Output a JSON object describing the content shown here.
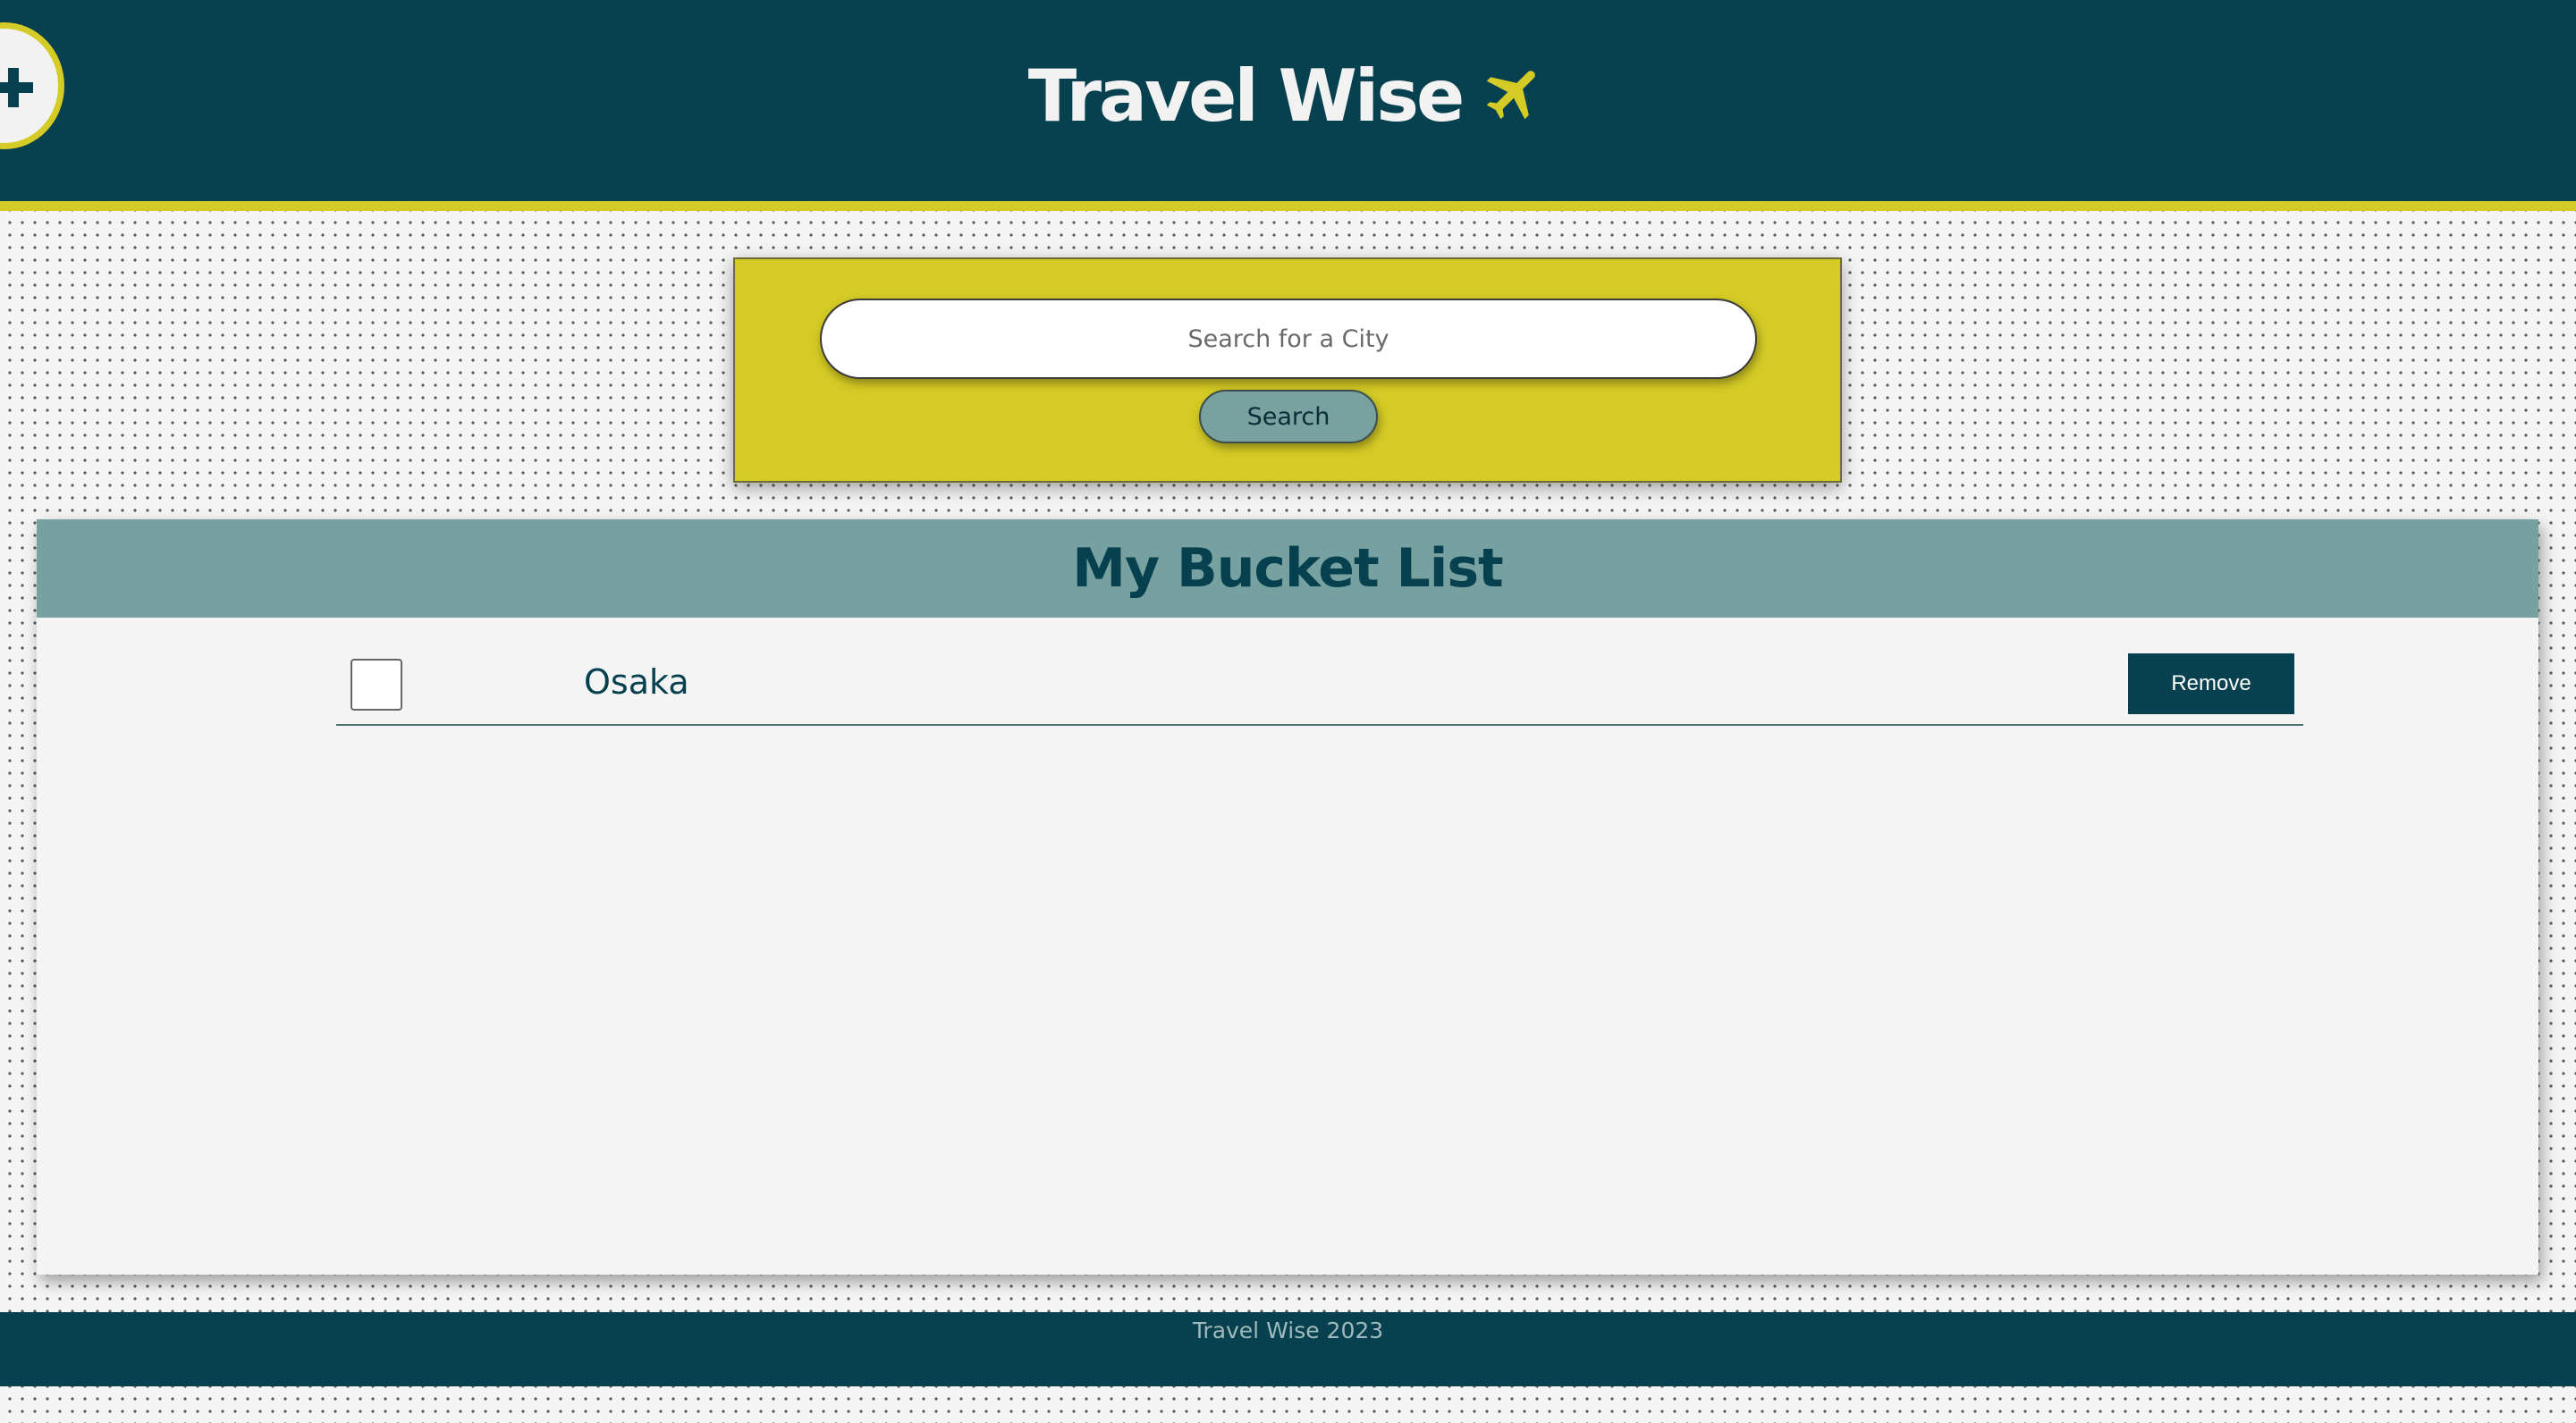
{
  "header": {
    "title": "Travel Wise",
    "logo_icon": "airplane-icon",
    "add_icon": "plus-icon"
  },
  "search": {
    "placeholder": "Search for a City",
    "value": "",
    "button_label": "Search"
  },
  "bucket_list": {
    "title": "My Bucket List",
    "items": [
      {
        "city": "Osaka",
        "checked": false,
        "remove_label": "Remove"
      }
    ]
  },
  "footer": {
    "text": "Travel Wise 2023"
  },
  "colors": {
    "primary": "#07414f",
    "accent": "#d5cb26",
    "secondary": "#77a1a0",
    "background": "#f4f4f4"
  }
}
